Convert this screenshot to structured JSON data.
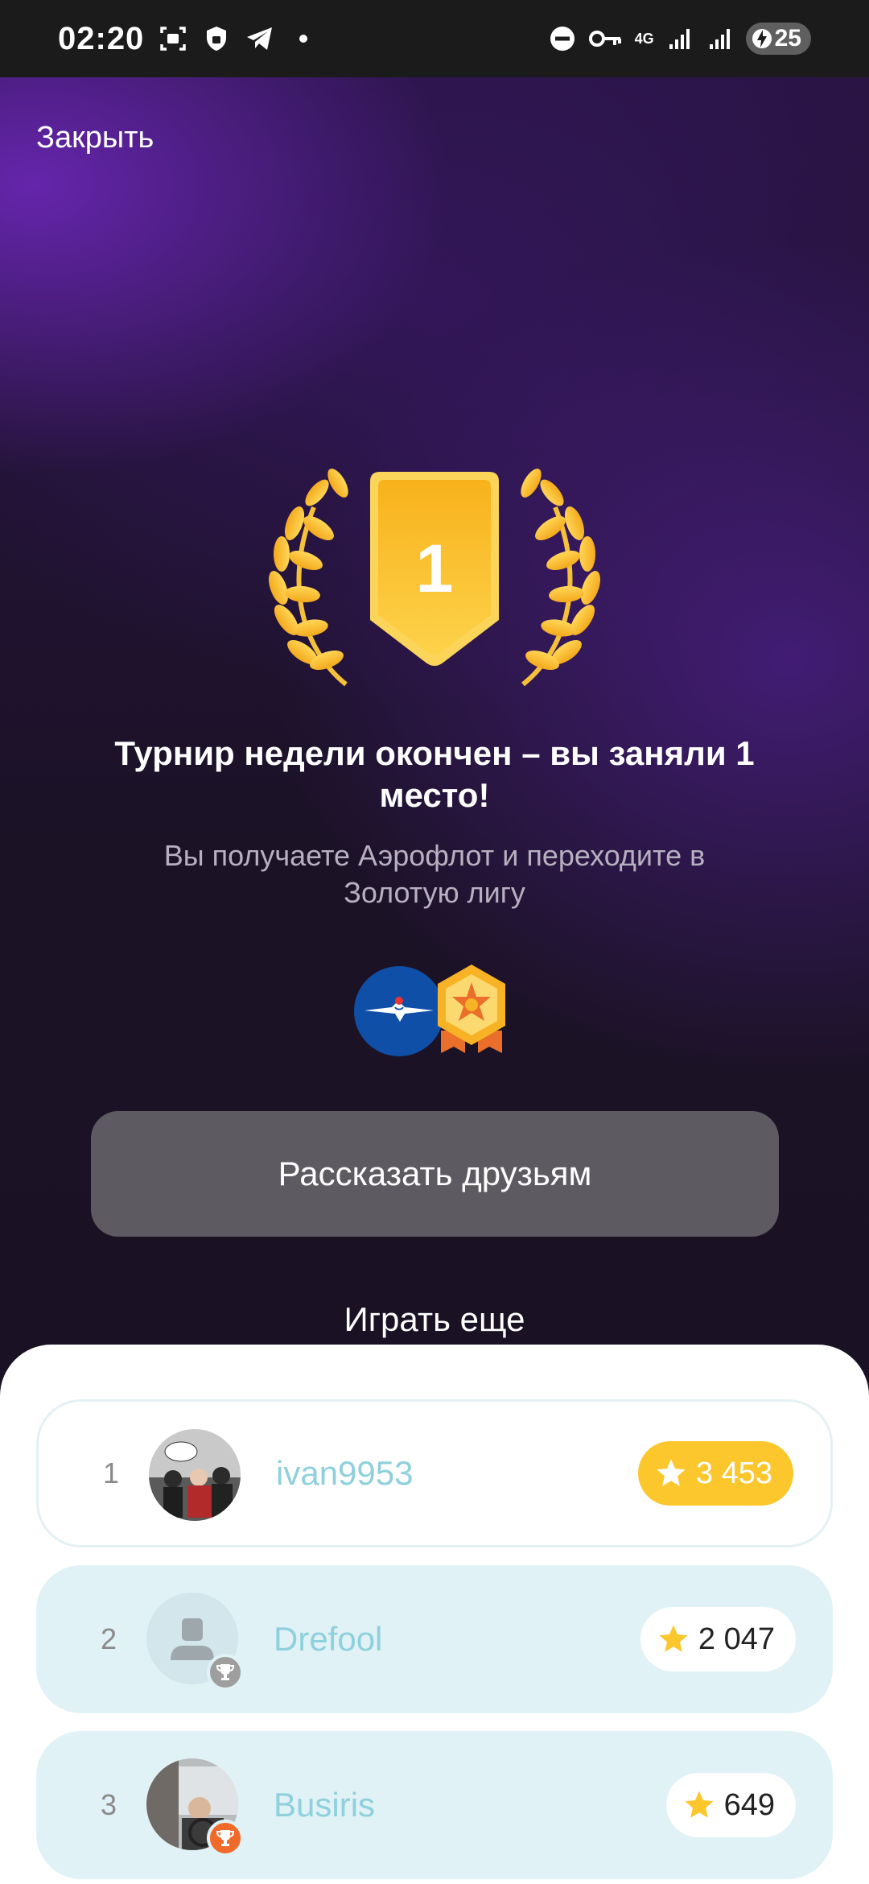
{
  "status_bar": {
    "time": "02:20",
    "network": "4G",
    "battery": "25",
    "icons": [
      "screenshot-icon",
      "vpn-shield-icon",
      "telegram-icon",
      "dot-icon",
      "do-not-disturb-icon",
      "key-icon",
      "signal-icon",
      "signal-icon",
      "battery-charging-icon"
    ]
  },
  "header": {
    "close_label": "Закрыть"
  },
  "result": {
    "rank": "1",
    "title": "Турнир недели окончен – вы заняли 1 место!",
    "subtitle": "Вы получаете Аэрофлот и переходите в Золотую лигу",
    "rewards": [
      "aeroflot-logo-icon",
      "gold-league-badge-icon"
    ]
  },
  "actions": {
    "share_label": "Рассказать друзьям",
    "play_more_label": "Играть еще"
  },
  "leaderboard": [
    {
      "rank": "1",
      "name": "ivan9953",
      "score": "3 453",
      "highlight": true
    },
    {
      "rank": "2",
      "name": "Drefool",
      "score": "2 047",
      "badge": "trophy-icon",
      "badge_color": "#9e9e9e"
    },
    {
      "rank": "3",
      "name": "Busiris",
      "score": "649",
      "badge": "trophy-icon",
      "badge_color": "#f06a2a"
    }
  ],
  "colors": {
    "accent_gold": "#fcc72d",
    "name_color": "#8ed0dc",
    "row_bg": "#e0f2f6",
    "share_button_bg": "#5e5a62"
  }
}
